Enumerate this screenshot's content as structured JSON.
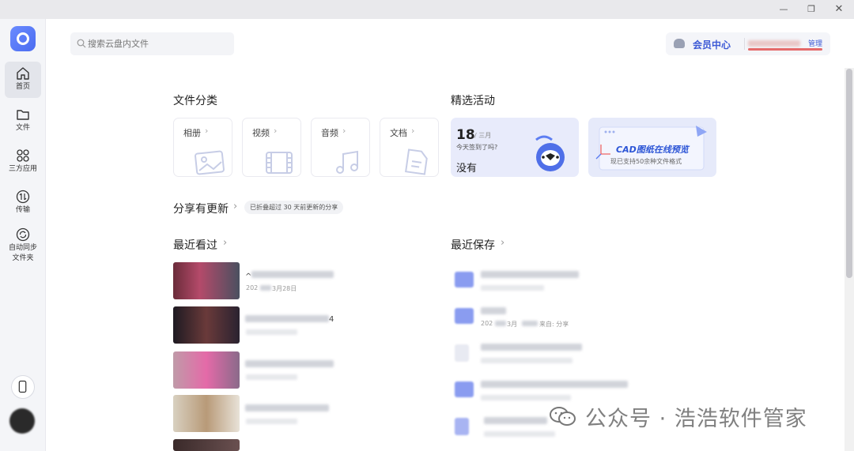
{
  "window": {
    "minimize_icon": "minimize-icon",
    "restore_icon": "restore-icon",
    "close_icon": "close-icon"
  },
  "sidebar": {
    "items": [
      {
        "label": "首页",
        "icon": "home-icon"
      },
      {
        "label": "文件",
        "icon": "folder-icon"
      },
      {
        "label": "三方应用",
        "icon": "apps-grid-icon"
      },
      {
        "label": "传输",
        "icon": "transfer-icon"
      },
      {
        "label": "自动同步",
        "label2": "文件夹",
        "icon": "sync-icon"
      }
    ]
  },
  "search": {
    "placeholder": "搜索云盘内文件"
  },
  "member": {
    "label": "会员中心",
    "manage": "管理"
  },
  "categories": {
    "title": "文件分类",
    "items": [
      {
        "label": "相册",
        "icon": "photo-icon"
      },
      {
        "label": "视频",
        "icon": "video-icon"
      },
      {
        "label": "音频",
        "icon": "music-icon"
      },
      {
        "label": "文档",
        "icon": "document-icon"
      }
    ]
  },
  "activities": {
    "title": "精选活动",
    "signin": {
      "day": "18",
      "month": "/ 三月",
      "question": "今天签到了吗?",
      "answer": "没有"
    },
    "cad": {
      "title": "CAD图纸在线预览",
      "subtitle": "现已支持50余种文件格式"
    }
  },
  "share": {
    "title": "分享有更新",
    "note": "已折叠超过 30 天前更新的分享"
  },
  "recent_viewed": {
    "title": "最近看过",
    "items": [
      {
        "title_char": "^",
        "date_prefix": "202",
        "date_suffix": "3月28日"
      },
      {
        "title_char": "4"
      },
      {},
      {},
      {}
    ]
  },
  "recent_saved": {
    "title": "最近保存",
    "items": [
      {},
      {
        "meta_prefix": "202",
        "meta_mid": "3月",
        "meta_source": "来自: 分享"
      },
      {},
      {},
      {}
    ]
  },
  "watermark": {
    "text": "公众号 · 浩浩软件管家"
  },
  "colors": {
    "accent": "#3e5bd6",
    "sidebar_bg": "#f4f5f8",
    "card_bg": "#e8ebfb"
  }
}
